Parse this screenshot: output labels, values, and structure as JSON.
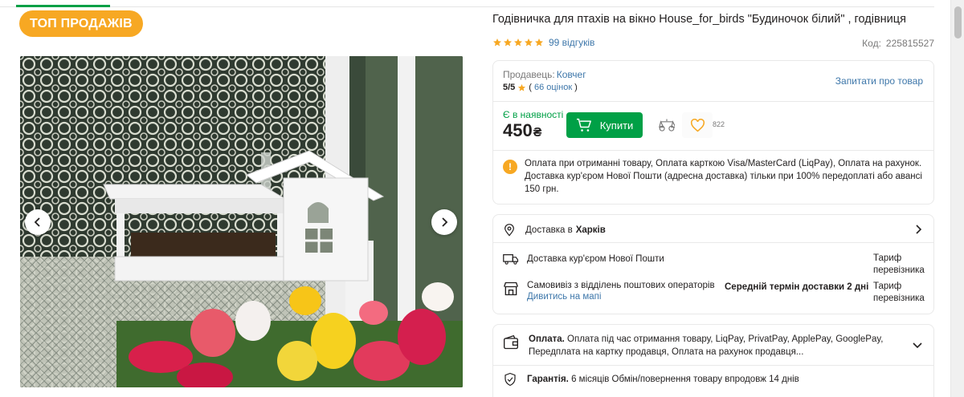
{
  "badge": {
    "label": "ТОП ПРОДАЖІВ"
  },
  "product": {
    "title": "Годівничка для птахів на вікно House_for_birds \"Будиночок білий\" , годівниця",
    "reviews_link": "99 відгуків",
    "rating_stars": 5,
    "code_label": "Код:",
    "code_value": "225815527"
  },
  "seller": {
    "label": "Продавець:",
    "name": "Ковчег",
    "score": "5/5",
    "reviews_open": "(",
    "reviews_count": "66 оцінок",
    "reviews_close": ")",
    "ask_link": "Запитати про товар"
  },
  "purchase": {
    "stock": "Є в наявності",
    "price": "450",
    "currency": "₴",
    "buy_label": "Купити",
    "wishlist_count": "822"
  },
  "payment_note": {
    "text": "Оплата при отриманні товару, Оплата карткою Visa/MasterCard (LiqPay), Оплата на рахунок. Доставка кур'єром Нової Пошти (адресна доставка) тільки при 100% передоплаті або авансі 150 грн."
  },
  "delivery": {
    "city_label": "Доставка в",
    "city": "Харків",
    "courier_label": "Доставка кур'єром Нової Пошти",
    "courier_tariff": "Тариф перевізника",
    "pickup_label": "Самовивіз з відділень поштових операторів",
    "pickup_term": "Середній термін доставки 2 дні",
    "map_link": "Дивитись на мапі",
    "pickup_tariff": "Тариф перевізника"
  },
  "payment": {
    "title": "Оплата.",
    "text": "Оплата під час отримання товару, LiqPay, PrivatPay, ApplePay, GooglePay, Передплата на картку продавця, Оплата на рахунок продавця...",
    "guarantee_title": "Гарантія.",
    "guarantee_text": "6 місяців Обмін/повернення товару впродовж 14 днів"
  },
  "colors": {
    "accent_green": "#00a046",
    "badge_orange": "#f7a823",
    "link_blue": "#3e77aa",
    "star_gold": "#f7a823"
  },
  "icons": [
    "chevron-left-icon",
    "chevron-right-icon",
    "star-icon",
    "cart-icon",
    "compare-icon",
    "heart-icon",
    "warning-icon",
    "location-pin-icon",
    "truck-icon",
    "store-icon",
    "wallet-icon",
    "shield-check-icon",
    "chevron-down-icon"
  ]
}
